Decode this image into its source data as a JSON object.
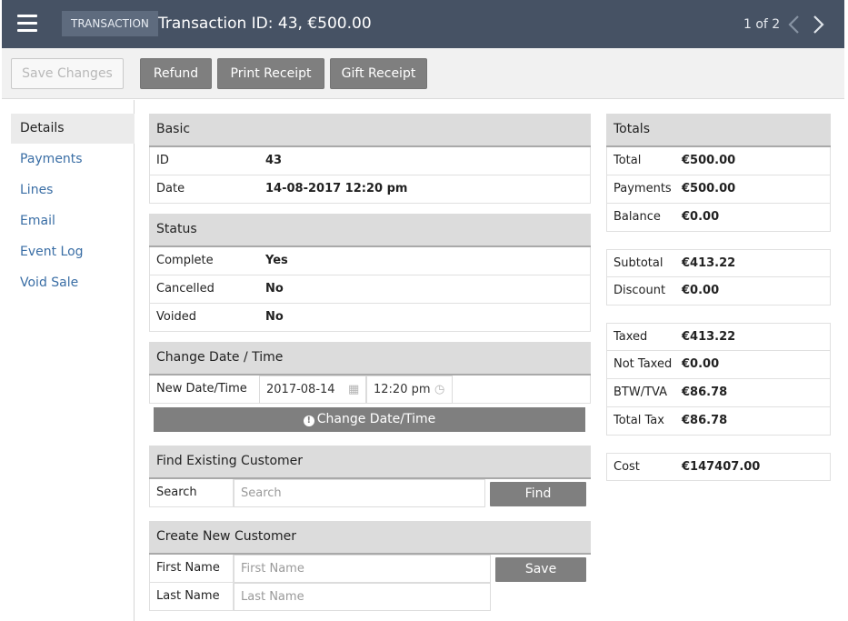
{
  "header": {
    "tag": "TRANSACTION",
    "title": "Transaction ID: 43, €500.00",
    "pager": "1 of 2"
  },
  "toolbar": {
    "save": "Save Changes",
    "refund": "Refund",
    "print": "Print Receipt",
    "gift": "Gift Receipt"
  },
  "sidebar": {
    "items": [
      {
        "label": "Details"
      },
      {
        "label": "Payments"
      },
      {
        "label": "Lines"
      },
      {
        "label": "Email"
      },
      {
        "label": "Event Log"
      },
      {
        "label": "Void Sale"
      }
    ]
  },
  "basic": {
    "title": "Basic",
    "id_label": "ID",
    "id_value": "43",
    "date_label": "Date",
    "date_value": "14-08-2017 12:20 pm"
  },
  "status": {
    "title": "Status",
    "complete_label": "Complete",
    "complete_value": "Yes",
    "cancelled_label": "Cancelled",
    "cancelled_value": "No",
    "voided_label": "Voided",
    "voided_value": "No"
  },
  "change_date": {
    "title": "Change Date / Time",
    "label": "New Date/Time",
    "date_value": "2017-08-14",
    "time_value": "12:20 pm",
    "button": "Change Date/Time"
  },
  "find_customer": {
    "title": "Find Existing Customer",
    "label": "Search",
    "placeholder": "Search",
    "button": "Find"
  },
  "new_customer": {
    "title": "Create New Customer",
    "first_label": "First Name",
    "first_placeholder": "First Name",
    "last_label": "Last Name",
    "last_placeholder": "Last Name",
    "button": "Save"
  },
  "totals": {
    "title": "Totals",
    "total_label": "Total",
    "total_value": "€500.00",
    "payments_label": "Payments",
    "payments_value": "€500.00",
    "balance_label": "Balance",
    "balance_value": "€0.00",
    "subtotal_label": "Subtotal",
    "subtotal_value": "€413.22",
    "discount_label": "Discount",
    "discount_value": "€0.00",
    "taxed_label": "Taxed",
    "taxed_value": "€413.22",
    "nottaxed_label": "Not Taxed",
    "nottaxed_value": "€0.00",
    "btw_label": "BTW/TVA",
    "btw_value": "€86.78",
    "totaltax_label": "Total Tax",
    "totaltax_value": "€86.78",
    "cost_label": "Cost",
    "cost_value": "€147407.00"
  }
}
